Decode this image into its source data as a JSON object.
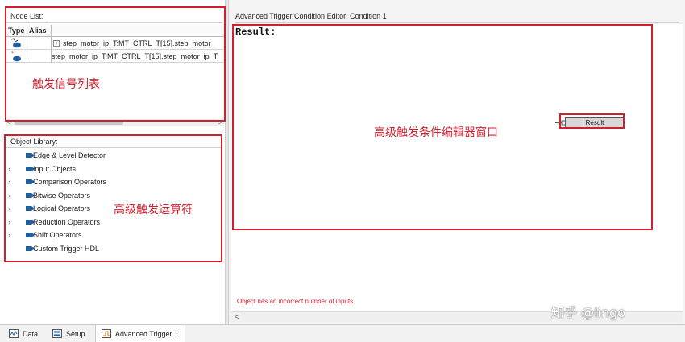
{
  "node_list": {
    "header": "Node List:",
    "columns": {
      "type": "Type",
      "alias": "Alias"
    },
    "rows": [
      {
        "name": "step_motor_ip_T:MT_CTRL_T[15].step_motor_",
        "expandable": true
      },
      {
        "name": "step_motor_ip_T:MT_CTRL_T[15].step_motor_ip_T",
        "expandable": false
      }
    ]
  },
  "object_library": {
    "header": "Object Library:",
    "items": [
      {
        "label": "Edge & Level Detector",
        "expandable": false
      },
      {
        "label": "Input Objects",
        "expandable": true
      },
      {
        "label": "Comparison Operators",
        "expandable": true
      },
      {
        "label": "Bitwise Operators",
        "expandable": true
      },
      {
        "label": "Logical Operators",
        "expandable": true
      },
      {
        "label": "Reduction Operators",
        "expandable": true
      },
      {
        "label": "Shift Operators",
        "expandable": true
      },
      {
        "label": "Custom Trigger HDL",
        "expandable": false
      }
    ]
  },
  "editor": {
    "title": "Advanced Trigger Condition Editor: Condition 1",
    "result_label": "Result:",
    "result_node": "Result",
    "error": "Object has an incorrect number of inputs."
  },
  "annotations": {
    "node_list": "触发信号列表",
    "editor": "高级触发条件编辑器窗口",
    "library": "高级触发运算符"
  },
  "watermark": "知乎 @lingo",
  "tabs": [
    {
      "label": "Data",
      "icon": "data-icon",
      "active": false
    },
    {
      "label": "Setup",
      "icon": "setup-icon",
      "active": false
    },
    {
      "label": "Advanced Trigger 1",
      "icon": "trigger-icon",
      "active": true
    }
  ],
  "colors": {
    "annotation_red": "#d21f2e",
    "error_red": "#d2222f",
    "icon_blue": "#1f5f9e"
  },
  "scroll_arrows": {
    "left": "<",
    "right": ">"
  }
}
